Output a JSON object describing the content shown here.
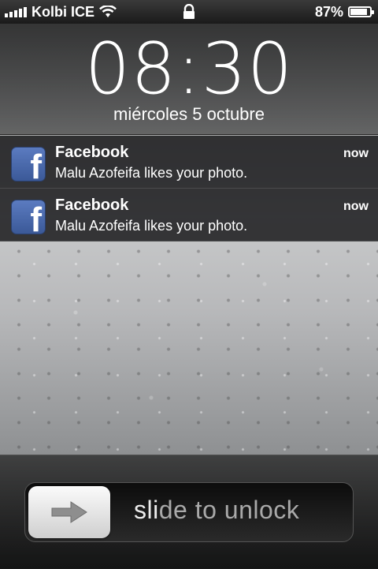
{
  "status_bar": {
    "carrier": "Kolbi ICE",
    "battery_percent": "87%",
    "battery_level": 0.87
  },
  "lock": {
    "time": "08:30",
    "date": "miércoles 5 octubre"
  },
  "notifications": [
    {
      "app": "Facebook",
      "message": "Malu Azofeifa likes your photo.",
      "time": "now",
      "icon": "facebook-icon"
    },
    {
      "app": "Facebook",
      "message": "Malu Azofeifa likes your photo.",
      "time": "now",
      "icon": "facebook-icon"
    }
  ],
  "slider": {
    "highlight_text": "sli",
    "rest_text": "de to unlock",
    "icon": "arrow-right-icon"
  },
  "colors": {
    "facebook": "#3b5998"
  }
}
